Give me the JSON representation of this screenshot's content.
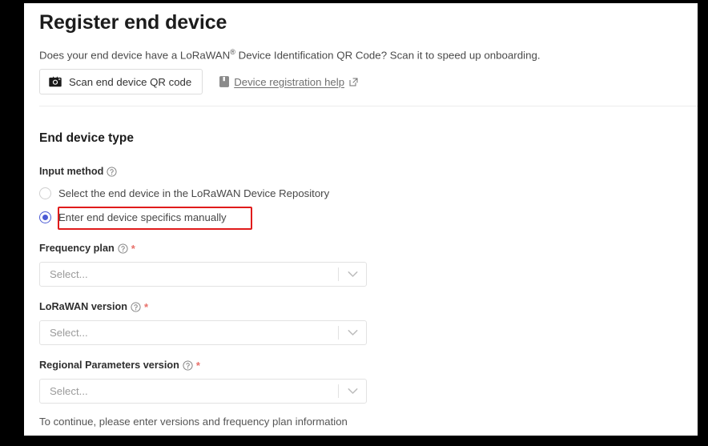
{
  "page": {
    "title": "Register end device",
    "intro": {
      "before": "Does your end device have a LoRaWAN",
      "sup": "®",
      "after": " Device Identification QR Code? Scan it to speed up onboarding."
    }
  },
  "actions": {
    "scan_button": {
      "label": "Scan end device QR code",
      "icon": "camera-icon"
    },
    "help_link": {
      "label": "Device registration help",
      "leading_icon": "book-icon",
      "trailing_icon": "external-link-icon"
    }
  },
  "section": {
    "title": "End device type",
    "input_method": {
      "label": "Input method",
      "help_icon": "question-circle-icon",
      "options": [
        {
          "label": "Select the end device in the LoRaWAN Device Repository",
          "selected": false
        },
        {
          "label": "Enter end device specifics manually",
          "selected": true
        }
      ]
    }
  },
  "fields": [
    {
      "label": "Frequency plan",
      "help_icon": "question-circle-icon",
      "required_marker": "*",
      "value": "",
      "placeholder": "Select...",
      "arrow_icon": "chevron-down-icon"
    },
    {
      "label": "LoRaWAN version",
      "help_icon": "question-circle-icon",
      "required_marker": "*",
      "value": "",
      "placeholder": "Select...",
      "arrow_icon": "chevron-down-icon"
    },
    {
      "label": "Regional Parameters version",
      "help_icon": "question-circle-icon",
      "required_marker": "*",
      "value": "",
      "placeholder": "Select...",
      "arrow_icon": "chevron-down-icon"
    }
  ],
  "footer": {
    "note": "To continue, please enter versions and frequency plan information"
  },
  "annotation": {
    "highlight_color": "#e01b1b",
    "highlight_target": "Enter end device specifics manually"
  },
  "colors": {
    "accent_radio": "#4b5bd4",
    "required_asterisk": "#e8706a",
    "text_primary": "#1c1c1c",
    "text_secondary": "#4a4a4a",
    "border": "#e2e2e2"
  }
}
